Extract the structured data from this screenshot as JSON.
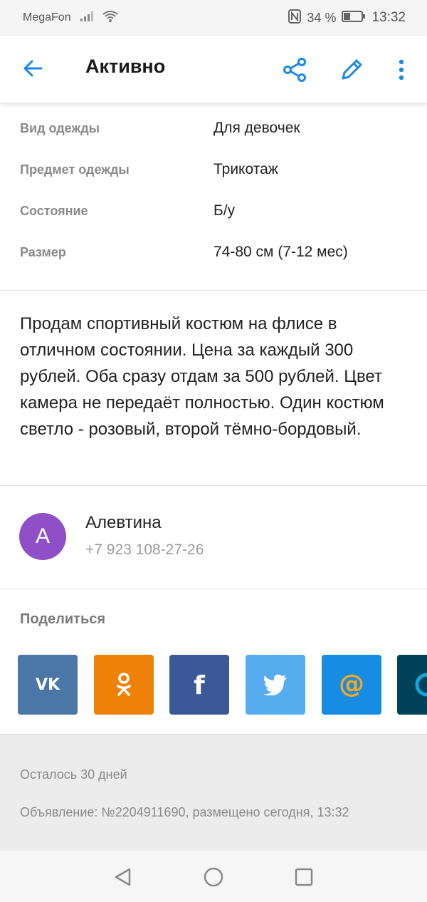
{
  "status_bar": {
    "carrier": "MegaFon",
    "battery": "34 %",
    "time": "13:32"
  },
  "app_bar": {
    "title": "Активно"
  },
  "params": [
    {
      "label": "Вид одежды",
      "value": "Для девочек"
    },
    {
      "label": "Предмет одежды",
      "value": "Трикотаж"
    },
    {
      "label": "Состояние",
      "value": "Б/у"
    },
    {
      "label": "Размер",
      "value": "74-80 см (7-12 мес)"
    }
  ],
  "description": "Продам спортивный костюм на флисе в отличном состоянии. Цена за каждый 300 рублей. Оба сразу отдам за 500 рублей. Цвет камера не передаёт полностью. Один костюм светло - розовый, второй тёмно-бордовый.",
  "seller": {
    "initial": "А",
    "name": "Алевтина",
    "phone": "+7 923 108-27-26"
  },
  "share": {
    "title": "Поделиться",
    "services": [
      {
        "name": "vk",
        "color": "#4a76a8"
      },
      {
        "name": "odnoklassniki",
        "color": "#ee8208"
      },
      {
        "name": "facebook",
        "color": "#3b5998"
      },
      {
        "name": "twitter",
        "color": "#55acee"
      },
      {
        "name": "mail-ru",
        "color": "#168de2"
      },
      {
        "name": "livejournal",
        "color": "#004359"
      }
    ]
  },
  "footer": {
    "days_left": "Осталось 30 дней",
    "ad_info": "Объявление: №2204911690, размещено сегодня, 13:32"
  },
  "colors": {
    "accent": "#1e88e5",
    "avatar": "#8e4fc7"
  }
}
